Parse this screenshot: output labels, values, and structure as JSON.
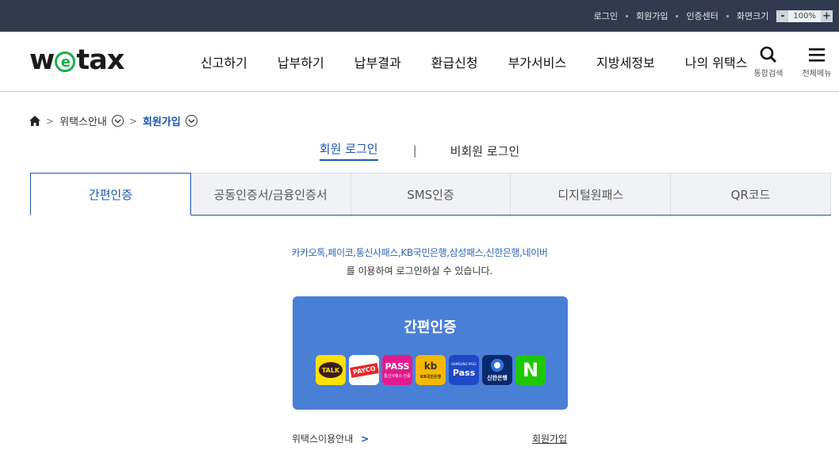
{
  "topbar": {
    "links": [
      "로그인",
      "회원가입",
      "인증센터"
    ],
    "zoom_label": "화면크기",
    "zoom_minus": "-",
    "zoom_value": "100%",
    "zoom_plus": "+"
  },
  "header": {
    "logo_pre": "w",
    "logo_e": "e",
    "logo_post": "tax",
    "nav": [
      "신고하기",
      "납부하기",
      "납부결과",
      "환급신청",
      "부가서비스",
      "지방세정보",
      "나의 위택스"
    ],
    "search_label": "통합검색",
    "menu_label": "전체메뉴"
  },
  "breadcrumb": {
    "level1": "위택스안내",
    "current": "회원가입"
  },
  "login_switch": {
    "member": "회원 로그인",
    "divider": "|",
    "non_member": "비회원 로그인"
  },
  "tabs": [
    "간편인증",
    "공동인증서/금융인증서",
    "SMS인증",
    "디지털원패스",
    "QR코드"
  ],
  "content": {
    "providers_text": "카카오톡,페이코,통신사패스,KB국민은행,삼성패스,신한은행,네이버",
    "desc_text": "를 이용하여 로그인하실 수 있습니다.",
    "panel_title": "간편인증",
    "providers": {
      "kakao": "TALK",
      "payco": "PAYCO",
      "pass": "PASS",
      "pass_sub": "통신사패스 인증",
      "kb": "kb",
      "kb_sub": "KB국민은행",
      "samsung": "Pass",
      "samsung_sub": "SAMSUNG PASS",
      "shinhan": "신한은행",
      "naver": "N"
    },
    "guide_link": "위택스이용안내",
    "guide_chev": ">",
    "join_link": "회원가입"
  }
}
